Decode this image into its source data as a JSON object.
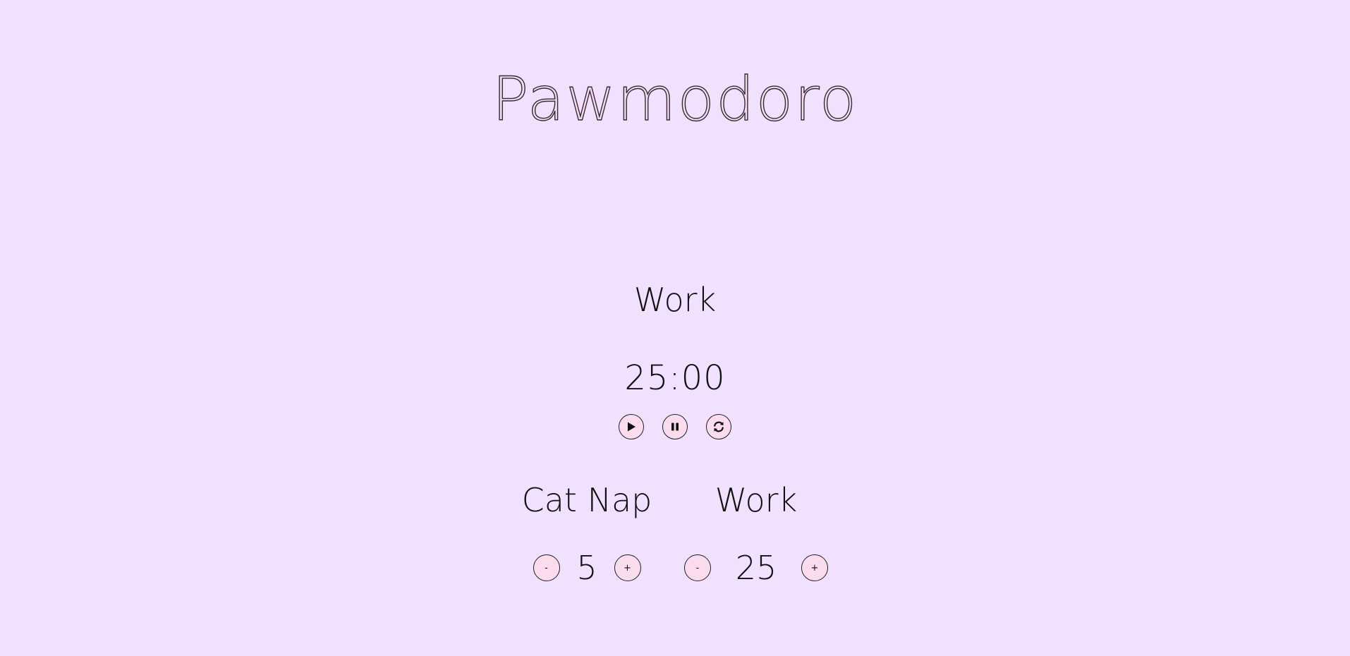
{
  "app": {
    "title": "Pawmodoro"
  },
  "timer": {
    "session_label": "Work",
    "display": "25:00"
  },
  "controls": {
    "play_icon": "play-icon",
    "pause_icon": "pause-icon",
    "reset_icon": "refresh-icon"
  },
  "settings": {
    "break": {
      "label": "Cat Nap",
      "decrement": "-",
      "value": "5",
      "increment": "+"
    },
    "work": {
      "label": "Work",
      "decrement": "-",
      "value": "25",
      "increment": "+"
    }
  },
  "colors": {
    "background": "#f1e1fe",
    "button_fill": "#fbdcef",
    "title_fill": "#f6dcef",
    "ink": "#111111"
  }
}
